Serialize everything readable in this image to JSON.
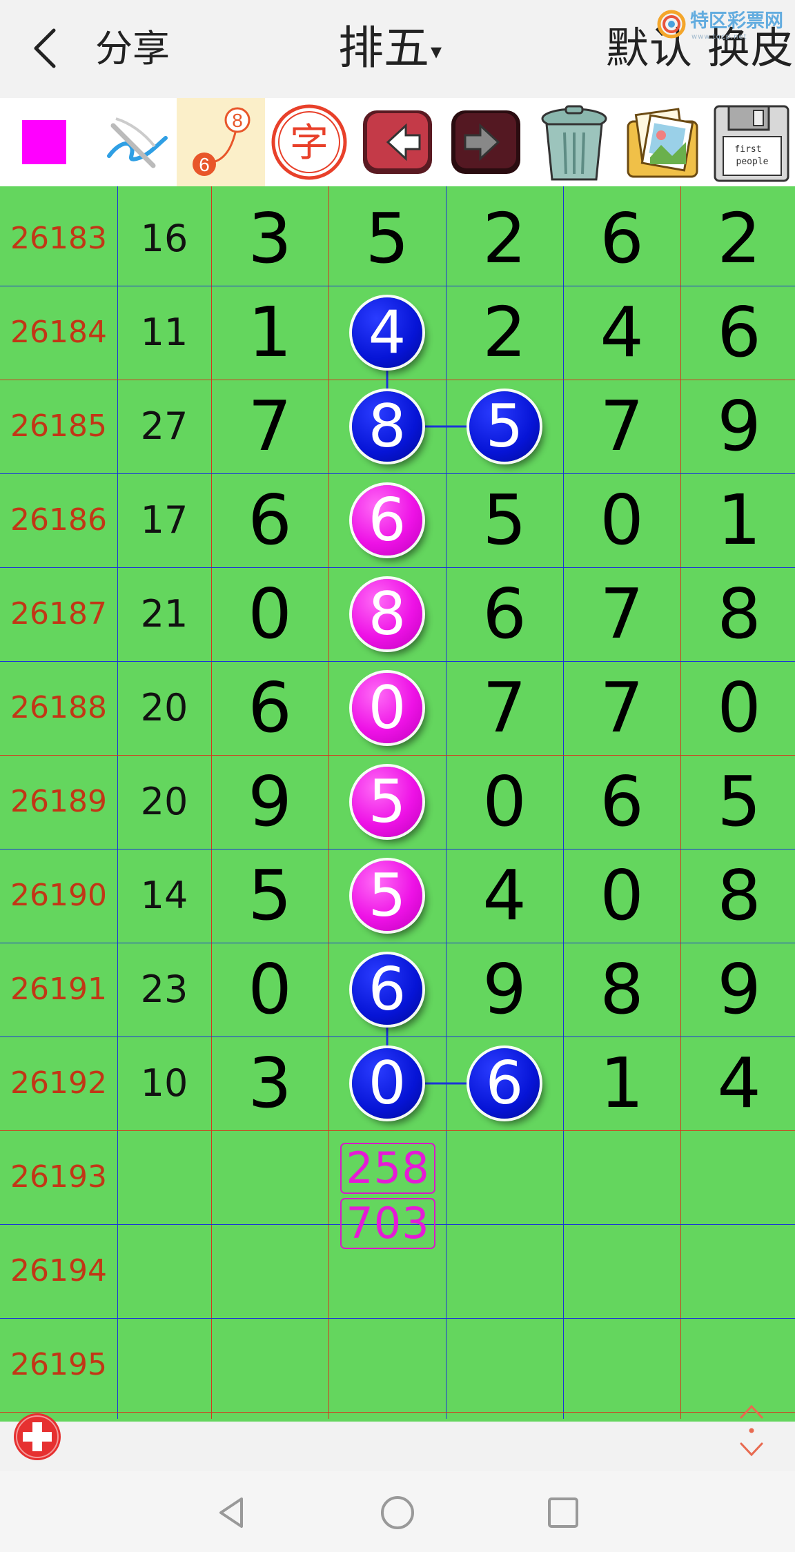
{
  "header": {
    "back_icon": "chevron-left-icon",
    "share_label": "分享",
    "title": "排五",
    "title_caret": "▾",
    "skin_label": "默认 换皮",
    "watermark_text": "特区彩票网",
    "watermark_sub": "www.tqcp.net"
  },
  "toolbar": {
    "items": [
      {
        "name": "color-swatch",
        "color": "#ff00ff"
      },
      {
        "name": "draw-tool-icon"
      },
      {
        "name": "connect-tool-icon",
        "top_number": "8",
        "bottom_number": "6"
      },
      {
        "name": "text-tool-icon",
        "label": "字"
      },
      {
        "name": "undo-arrow-icon"
      },
      {
        "name": "redo-arrow-icon"
      },
      {
        "name": "trash-icon"
      },
      {
        "name": "photos-icon"
      },
      {
        "name": "save-disk-icon",
        "label_line1": "first",
        "label_line2": "people"
      }
    ]
  },
  "colors": {
    "grid_bg": "#64d65e",
    "issue_text": "#c23616",
    "ball_blue": "#0614d6",
    "ball_pink": "#ee12e6",
    "line_red": "#d23a1e",
    "line_blue": "#1b35d8"
  },
  "rows": [
    {
      "issue": "26183",
      "sum": "16",
      "digits": [
        "3",
        "5",
        "2",
        "6",
        "2"
      ]
    },
    {
      "issue": "26184",
      "sum": "11",
      "digits": [
        "1",
        "4",
        "2",
        "4",
        "6"
      ]
    },
    {
      "issue": "26185",
      "sum": "27",
      "digits": [
        "7",
        "8",
        "5",
        "7",
        "9"
      ]
    },
    {
      "issue": "26186",
      "sum": "17",
      "digits": [
        "6",
        "6",
        "5",
        "0",
        "1"
      ]
    },
    {
      "issue": "26187",
      "sum": "21",
      "digits": [
        "0",
        "8",
        "6",
        "7",
        "8"
      ]
    },
    {
      "issue": "26188",
      "sum": "20",
      "digits": [
        "6",
        "0",
        "7",
        "7",
        "0"
      ]
    },
    {
      "issue": "26189",
      "sum": "20",
      "digits": [
        "9",
        "5",
        "0",
        "6",
        "5"
      ]
    },
    {
      "issue": "26190",
      "sum": "14",
      "digits": [
        "5",
        "5",
        "4",
        "0",
        "8"
      ]
    },
    {
      "issue": "26191",
      "sum": "23",
      "digits": [
        "0",
        "6",
        "9",
        "8",
        "9"
      ]
    },
    {
      "issue": "26192",
      "sum": "10",
      "digits": [
        "3",
        "0",
        "6",
        "1",
        "4"
      ]
    },
    {
      "issue": "26193",
      "sum": "",
      "digits": [
        "",
        "",
        "",
        "",
        ""
      ]
    },
    {
      "issue": "26194",
      "sum": "",
      "digits": [
        "",
        "",
        "",
        "",
        ""
      ]
    },
    {
      "issue": "26195",
      "sum": "",
      "digits": [
        "",
        "",
        "",
        "",
        ""
      ]
    }
  ],
  "balls": [
    {
      "row": 1,
      "col": 1,
      "color": "blue"
    },
    {
      "row": 2,
      "col": 1,
      "color": "blue"
    },
    {
      "row": 2,
      "col": 2,
      "color": "blue"
    },
    {
      "row": 3,
      "col": 1,
      "color": "pink"
    },
    {
      "row": 4,
      "col": 1,
      "color": "pink"
    },
    {
      "row": 5,
      "col": 1,
      "color": "pink"
    },
    {
      "row": 6,
      "col": 1,
      "color": "pink"
    },
    {
      "row": 7,
      "col": 1,
      "color": "pink"
    },
    {
      "row": 8,
      "col": 1,
      "color": "blue"
    },
    {
      "row": 9,
      "col": 1,
      "color": "blue"
    },
    {
      "row": 9,
      "col": 2,
      "color": "blue"
    }
  ],
  "connectors": [
    {
      "from": [
        1,
        1
      ],
      "to": [
        2,
        1
      ]
    },
    {
      "from": [
        2,
        1
      ],
      "to": [
        2,
        2
      ]
    },
    {
      "from": [
        8,
        1
      ],
      "to": [
        9,
        1
      ]
    },
    {
      "from": [
        9,
        1
      ],
      "to": [
        9,
        2
      ]
    }
  ],
  "predictions": [
    {
      "row": 10,
      "text": "258"
    },
    {
      "row": 11,
      "text": "703"
    }
  ],
  "footer": {
    "add_icon": "add-circle-icon",
    "scroll_icon": "scroll-arrows-icon"
  },
  "navbar": {
    "back_icon": "nav-back-triangle-icon",
    "home_icon": "nav-home-circle-icon",
    "recents_icon": "nav-recents-square-icon"
  }
}
